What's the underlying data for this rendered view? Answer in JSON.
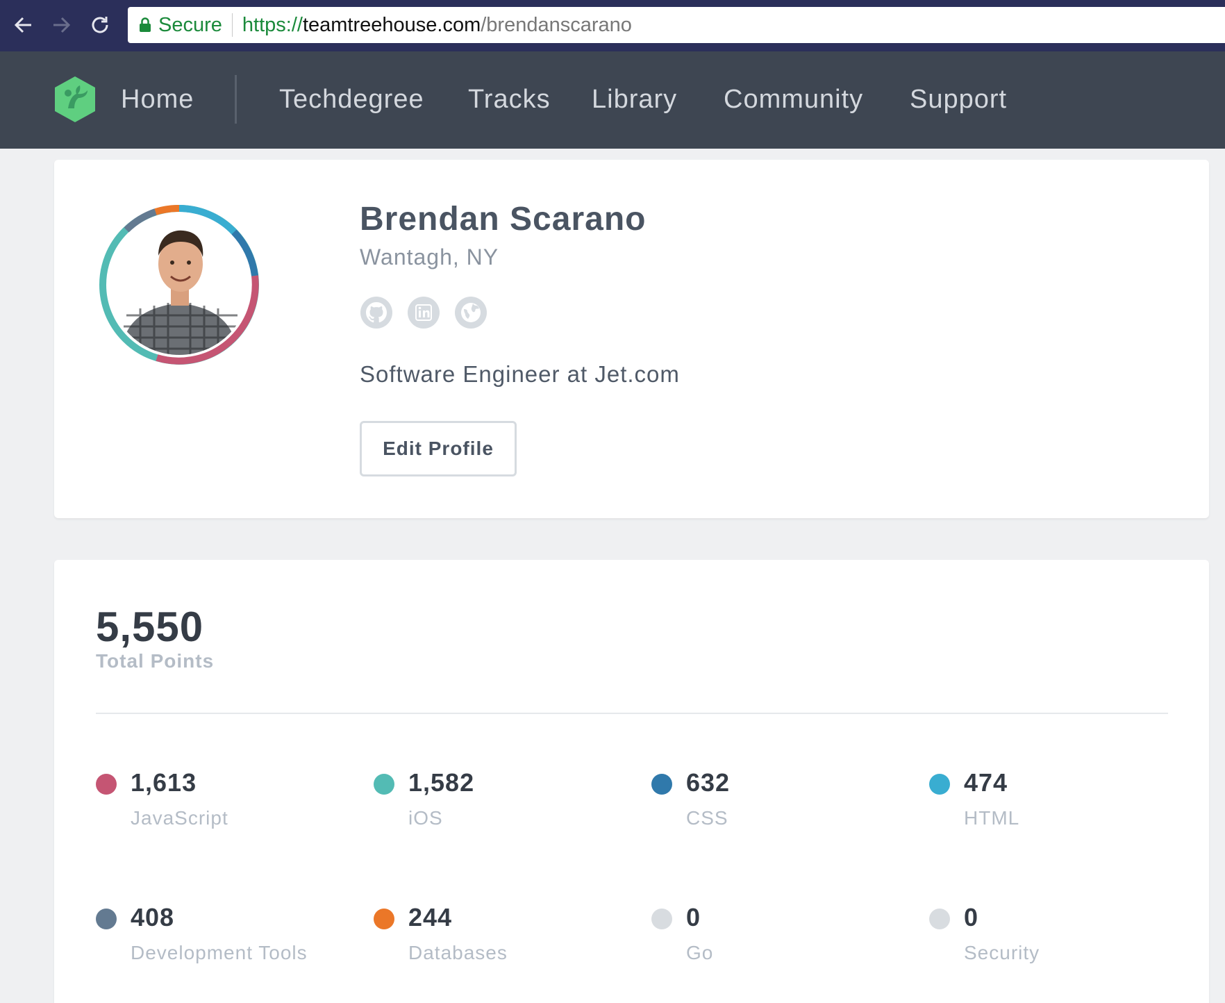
{
  "browser": {
    "secure_label": "Secure",
    "url_scheme": "https://",
    "url_host": "teamtreehouse.com",
    "url_path": "/brendanscarano"
  },
  "nav": {
    "home": "Home",
    "items": [
      "Techdegree",
      "Tracks",
      "Library",
      "Community",
      "Support"
    ]
  },
  "profile": {
    "name": "Brendan Scarano",
    "location": "Wantagh, NY",
    "bio": "Software Engineer at Jet.com",
    "edit_button": "Edit Profile",
    "social_icons": [
      "github-icon",
      "linkedin-icon",
      "website-icon"
    ]
  },
  "points": {
    "total": "5,550",
    "total_label": "Total Points",
    "categories": [
      {
        "value": "1,613",
        "label": "JavaScript",
        "color": "#c55573"
      },
      {
        "value": "1,582",
        "label": "iOS",
        "color": "#53bbb4"
      },
      {
        "value": "632",
        "label": "CSS",
        "color": "#3079ab"
      },
      {
        "value": "474",
        "label": "HTML",
        "color": "#39add1"
      },
      {
        "value": "408",
        "label": "Development Tools",
        "color": "#637a91"
      },
      {
        "value": "244",
        "label": "Databases",
        "color": "#eb7728"
      },
      {
        "value": "0",
        "label": "Go",
        "color": "#d8dce0"
      },
      {
        "value": "0",
        "label": "Security",
        "color": "#d8dce0"
      }
    ]
  },
  "colors": {
    "nav_bg": "#3e4652",
    "brand_green": "#5fcf80"
  }
}
